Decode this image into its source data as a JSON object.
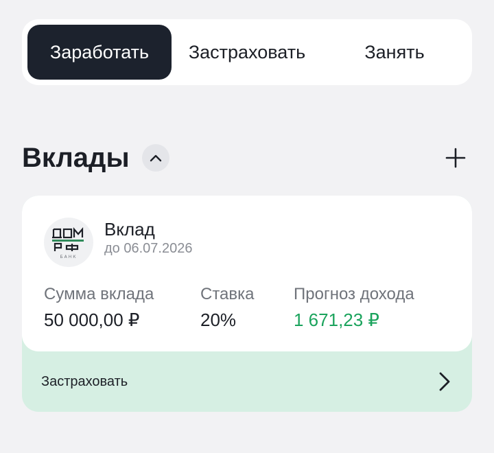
{
  "tabs": [
    {
      "label": "Заработать",
      "active": true
    },
    {
      "label": "Застраховать",
      "active": false
    },
    {
      "label": "Занять",
      "active": false
    }
  ],
  "section": {
    "title": "Вклады",
    "collapse_icon": "chevron-up-icon",
    "add_icon": "plus-icon"
  },
  "deposit": {
    "logo_text": "ДОМ РФ",
    "logo_subtext": "БАНК",
    "title": "Вклад",
    "date": "до 06.07.2026",
    "amount_label": "Сумма вклада",
    "amount_value": "50 000,00 ₽",
    "rate_label": "Ставка",
    "rate_value": "20%",
    "income_label": "Прогноз дохода",
    "income_value": "1 671,23 ₽",
    "insure_label": "Застраховать"
  },
  "colors": {
    "active_tab": "#1c222d",
    "income_green": "#1aa35c",
    "insure_bg": "#d6efe3",
    "logo_green": "#2f8a5a"
  }
}
